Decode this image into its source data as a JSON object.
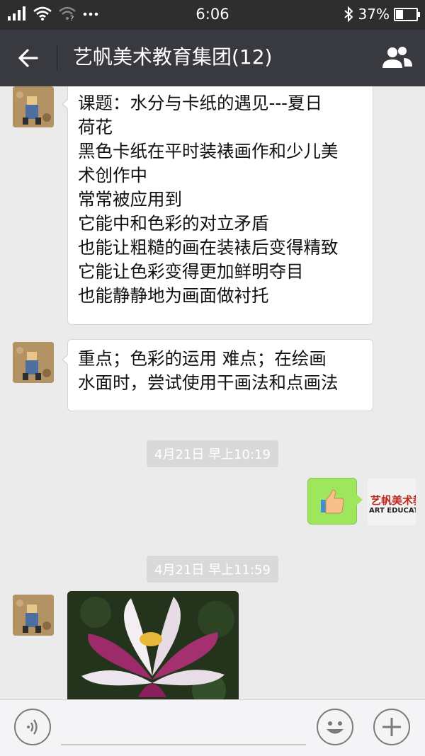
{
  "status_bar": {
    "time": "6:06",
    "battery_percent": "37%",
    "battery_level": 0.37
  },
  "nav": {
    "title": "艺帆美术教育集团(12)"
  },
  "messages": [
    {
      "lines": [
        "课题：水分与卡纸的遇见---夏日",
        "荷花",
        "黑色卡纸在平时装裱画作和少儿美",
        "术创作中",
        "常常被应用到",
        "它能中和色彩的对立矛盾",
        "也能让粗糙的画在装裱后变得精致",
        "它能让色彩变得更加鲜明夺目",
        "也能静静地为画面做衬托"
      ]
    },
    {
      "lines": [
        "重点；色彩的运用  难点；在绘画",
        "水面时，尝试使用干画法和点画法"
      ]
    }
  ],
  "timestamps": [
    "4月21日 早上10:19",
    "4月21日 早上11:59"
  ],
  "self_avatar": {
    "logo_cn": "艺帆美术教育",
    "logo_en": "ART EDUCATION"
  },
  "icons": {
    "back": "arrow-left-icon",
    "contacts": "group-contacts-icon",
    "thumbs_up": "thumbs-up-emoji",
    "voice": "voice-icon",
    "emoji": "smiley-icon",
    "plus": "plus-icon"
  },
  "colors": {
    "nav_bg": "#393a3f",
    "chat_bg": "#ebebeb",
    "sent_bubble": "#9ee65c"
  }
}
